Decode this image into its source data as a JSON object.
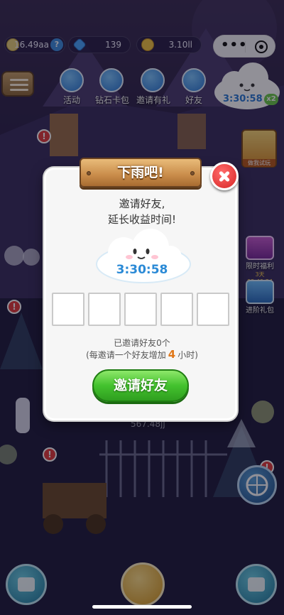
{
  "resources": {
    "money": "16.49aa",
    "gems": "139",
    "coins": "3.10ll",
    "help_glyph": "?"
  },
  "top_icons": [
    {
      "label": "活动",
      "icon": "activity-icon"
    },
    {
      "label": "钻石卡包",
      "icon": "diamond-card-icon"
    },
    {
      "label": "邀请有礼",
      "icon": "invite-gift-icon"
    },
    {
      "label": "好友",
      "icon": "friends-icon"
    }
  ],
  "top_cloud": {
    "timer": "3:30:58",
    "multiplier": "x2"
  },
  "side": {
    "card_caption": "做我试玩",
    "limited_gift_label": "限时福利",
    "limited_gift_timer": "3天 02:49:34",
    "advanced_gift_label": "进阶礼包"
  },
  "badges": {
    "alert": "!"
  },
  "background_text": "567.48jj",
  "dialog": {
    "title": "下雨吧!",
    "message_line1": "邀请好友,",
    "message_line2": "延长收益时间!",
    "cloud_timer": "3:30:58",
    "invited_text": "已邀请好友0个",
    "per_invite_prefix": "(每邀请一个好友增加",
    "per_invite_hours": "4",
    "per_invite_suffix": "小时)",
    "invite_button": "邀请好友",
    "slot_count": 5
  },
  "colors": {
    "invite_button": "#43c22e",
    "close_button": "#d72525",
    "timer_blue": "#2b8ad6",
    "highlight_orange": "#e0781a",
    "plank": "#c98c4a"
  }
}
